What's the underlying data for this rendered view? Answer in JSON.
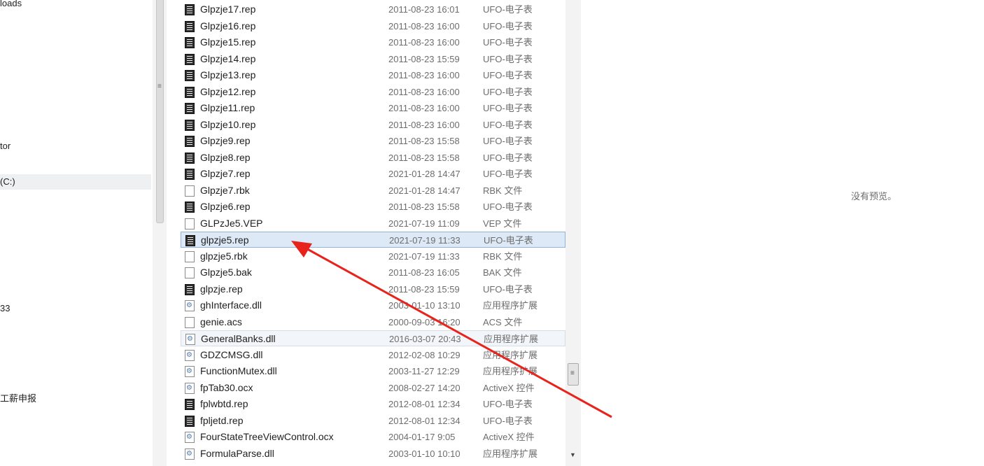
{
  "nav": {
    "items": [
      {
        "label": "loads"
      },
      {
        "label": "tor"
      },
      {
        "label": "(C:)"
      },
      {
        "label": "33"
      },
      {
        "label": "工薪申报"
      }
    ]
  },
  "files": [
    {
      "name": "Glpzje17.rep",
      "date": "2011-08-23 16:01",
      "type": "UFO-电子表",
      "icon": "rep-file-icon"
    },
    {
      "name": "Glpzje16.rep",
      "date": "2011-08-23 16:00",
      "type": "UFO-电子表",
      "icon": "rep-file-icon"
    },
    {
      "name": "Glpzje15.rep",
      "date": "2011-08-23 16:00",
      "type": "UFO-电子表",
      "icon": "rep-file-icon"
    },
    {
      "name": "Glpzje14.rep",
      "date": "2011-08-23 15:59",
      "type": "UFO-电子表",
      "icon": "rep-file-icon"
    },
    {
      "name": "Glpzje13.rep",
      "date": "2011-08-23 16:00",
      "type": "UFO-电子表",
      "icon": "rep-file-icon"
    },
    {
      "name": "Glpzje12.rep",
      "date": "2011-08-23 16:00",
      "type": "UFO-电子表",
      "icon": "rep-file-icon"
    },
    {
      "name": "Glpzje11.rep",
      "date": "2011-08-23 16:00",
      "type": "UFO-电子表",
      "icon": "rep-file-icon"
    },
    {
      "name": "Glpzje10.rep",
      "date": "2011-08-23 16:00",
      "type": "UFO-电子表",
      "icon": "rep-file-icon"
    },
    {
      "name": "Glpzje9.rep",
      "date": "2011-08-23 15:58",
      "type": "UFO-电子表",
      "icon": "rep-file-icon"
    },
    {
      "name": "Glpzje8.rep",
      "date": "2011-08-23 15:58",
      "type": "UFO-电子表",
      "icon": "rep-file-icon"
    },
    {
      "name": "Glpzje7.rep",
      "date": "2021-01-28 14:47",
      "type": "UFO-电子表",
      "icon": "rep-file-icon"
    },
    {
      "name": "Glpzje7.rbk",
      "date": "2021-01-28 14:47",
      "type": "RBK 文件",
      "icon": "blank-file-icon"
    },
    {
      "name": "Glpzje6.rep",
      "date": "2011-08-23 15:58",
      "type": "UFO-电子表",
      "icon": "rep-file-icon"
    },
    {
      "name": "GLPzJe5.VEP",
      "date": "2021-07-19 11:09",
      "type": "VEP 文件",
      "icon": "blank-file-icon"
    },
    {
      "name": "glpzje5.rep",
      "date": "2021-07-19 11:33",
      "type": "UFO-电子表",
      "icon": "rep-file-icon",
      "selected": true
    },
    {
      "name": "glpzje5.rbk",
      "date": "2021-07-19 11:33",
      "type": "RBK 文件",
      "icon": "blank-file-icon"
    },
    {
      "name": "Glpzje5.bak",
      "date": "2011-08-23 16:05",
      "type": "BAK 文件",
      "icon": "blank-file-icon"
    },
    {
      "name": "glpzje.rep",
      "date": "2011-08-23 15:59",
      "type": "UFO-电子表",
      "icon": "rep-file-icon"
    },
    {
      "name": "ghInterface.dll",
      "date": "2003-01-10 13:10",
      "type": "应用程序扩展",
      "icon": "dll-file-icon"
    },
    {
      "name": "genie.acs",
      "date": "2000-09-03 16:20",
      "type": "ACS 文件",
      "icon": "blank-file-icon"
    },
    {
      "name": "GeneralBanks.dll",
      "date": "2016-03-07 20:43",
      "type": "应用程序扩展",
      "icon": "dll-file-icon",
      "hover": true
    },
    {
      "name": "GDZCMSG.dll",
      "date": "2012-02-08 10:29",
      "type": "应用程序扩展",
      "icon": "dll-file-icon"
    },
    {
      "name": "FunctionMutex.dll",
      "date": "2003-11-27 12:29",
      "type": "应用程序扩展",
      "icon": "dll-file-icon"
    },
    {
      "name": "fpTab30.ocx",
      "date": "2008-02-27 14:20",
      "type": "ActiveX 控件",
      "icon": "dll-file-icon"
    },
    {
      "name": "fplwbtd.rep",
      "date": "2012-08-01 12:34",
      "type": "UFO-电子表",
      "icon": "rep-file-icon"
    },
    {
      "name": "fpljetd.rep",
      "date": "2012-08-01 12:34",
      "type": "UFO-电子表",
      "icon": "rep-file-icon"
    },
    {
      "name": "FourStateTreeViewControl.ocx",
      "date": "2004-01-17 9:05",
      "type": "ActiveX 控件",
      "icon": "dll-file-icon"
    },
    {
      "name": "FormulaParse.dll",
      "date": "2003-01-10 10:10",
      "type": "应用程序扩展",
      "icon": "dll-file-icon"
    }
  ],
  "preview": {
    "message": "没有预览。"
  },
  "colors": {
    "selected_bg": "#dde9f6",
    "selected_border": "#8fb3d9",
    "annotation_arrow": "#e8231c"
  }
}
